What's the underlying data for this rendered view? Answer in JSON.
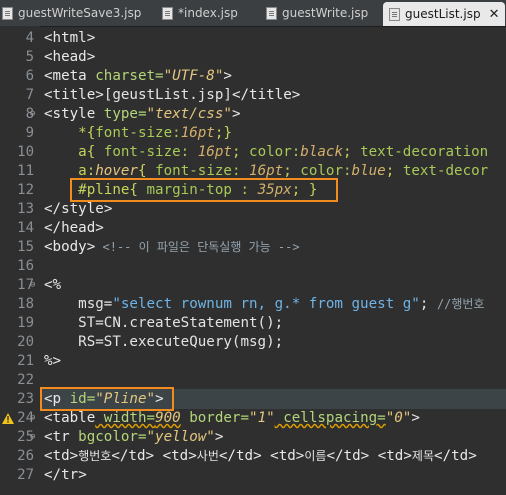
{
  "tabs": [
    {
      "label": "guestWriteSave3.jsp"
    },
    {
      "label": "*index.jsp"
    },
    {
      "label": "guestWrite.jsp"
    },
    {
      "label": "guestList.jsp",
      "active": true,
      "close": "✕"
    }
  ],
  "line_numbers": [
    "4",
    "5",
    "6",
    "7",
    "8",
    "9",
    "10",
    "11",
    "12",
    "13",
    "14",
    "15",
    "16",
    "17",
    "18",
    "19",
    "20",
    "21",
    "22",
    "23",
    "24",
    "25",
    "26",
    "27"
  ],
  "code": {
    "l4": {
      "open": "<",
      "tag": "html",
      "close": ">"
    },
    "l5": {
      "open": "<",
      "tag": "head",
      "close": ">"
    },
    "l6": {
      "open": "<",
      "tag": "meta",
      "attr": " charset=",
      "val": "\"UTF-8\"",
      "close": ">"
    },
    "l7": {
      "open": "<",
      "tag": "title",
      "close": ">",
      "text": "[geustList.jsp]",
      "end_open": "</",
      "end_tag": "title",
      "end_close": ">"
    },
    "l8": {
      "open": "<",
      "tag": "style",
      "attr": " type=",
      "val": "\"text/css\"",
      "close": ">"
    },
    "l9": {
      "sel": "*{",
      "prop": "font-size:",
      "val": "16pt",
      "end": ";}"
    },
    "l10": {
      "sel": "a{",
      "prop1": " font-size: ",
      "val1": "16pt",
      "sep1": "; ",
      "prop2": "color:",
      "val2": "black",
      "sep2": "; ",
      "prop3": "text-decoration"
    },
    "l11": {
      "sel": "a:",
      "pseudo": "hover",
      "brace": "{",
      "prop1": " font-size: ",
      "val1": "16pt",
      "sep1": "; ",
      "prop2": "color:",
      "val2": "blue",
      "sep2": "; ",
      "prop3": "text-decor"
    },
    "l12": {
      "sel": "#pline{",
      "prop": " margin-top : ",
      "val": "35px",
      "end": "; }"
    },
    "l13": {
      "open": "</",
      "tag": "style",
      "close": ">"
    },
    "l14": {
      "open": "</",
      "tag": "head",
      "close": ">"
    },
    "l15": {
      "open": "<",
      "tag": "body",
      "close": ">",
      "comment": " <!-- 이 파일은 단독실행 가능 -->"
    },
    "l16": {
      "text": ""
    },
    "l17": {
      "text": "<%"
    },
    "l18": {
      "pre": "msg=",
      "str": "\"select rownum rn, g.* from guest g\"",
      "post": "; ",
      "comment": "//행번호"
    },
    "l19": {
      "text": "ST=CN.createStatement();"
    },
    "l20": {
      "text": "RS=ST.executeQuery(msg);"
    },
    "l21": {
      "text": "%>"
    },
    "l22": {
      "text": ""
    },
    "l23": {
      "open": "<",
      "tag": "p",
      "attr": " id=",
      "val": "\"Pline\"",
      "close": ">"
    },
    "l24": {
      "open": "<",
      "tag": "table",
      "attr1": " width=",
      "val1": "900",
      "attr2": " border=",
      "val2": "\"1\"",
      "attr3": " cellspacing=",
      "val3": "\"0\"",
      "close": ">"
    },
    "l25": {
      "open": "<",
      "tag": "tr",
      "attr": " bgcolor=",
      "val": "\"yellow\"",
      "close": ">"
    },
    "l26": {
      "cells": [
        "행번호",
        "사번",
        "이름",
        "제목"
      ]
    },
    "l27": {
      "open": "</",
      "tag": "tr",
      "close": ">"
    }
  },
  "colors": {
    "background": "#2f2f2f",
    "highlight_box": "#f28c1e",
    "string": "#e3c67e",
    "css_property": "#a7c957",
    "comment": "#93a3ae"
  }
}
